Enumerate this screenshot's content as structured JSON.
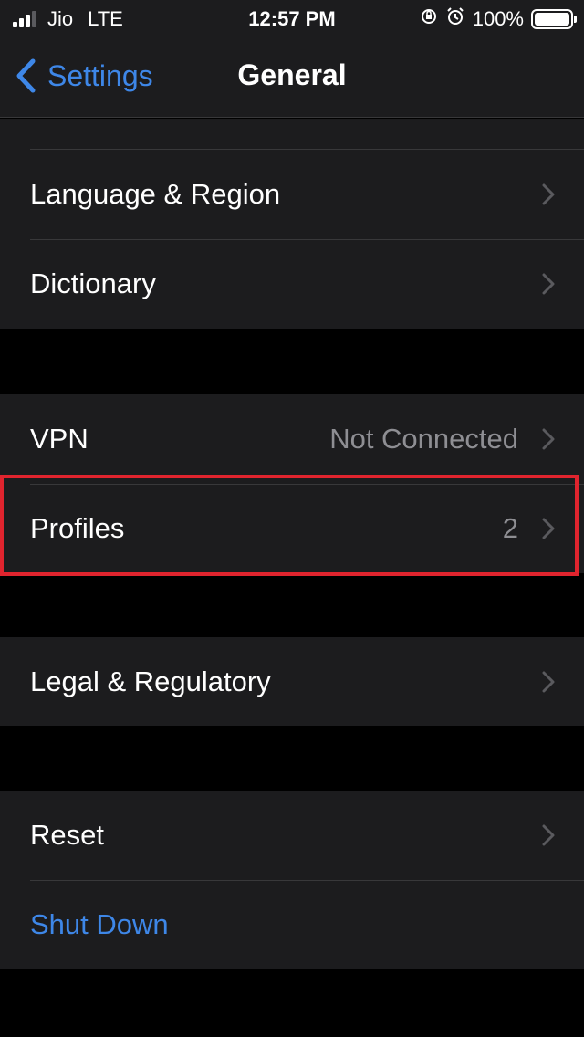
{
  "status_bar": {
    "carrier": "Jio",
    "network": "LTE",
    "time": "12:57 PM",
    "battery": "100%"
  },
  "nav": {
    "back_label": "Settings",
    "title": "General"
  },
  "groups": [
    {
      "rows": [
        {
          "label": "Language & Region",
          "value": ""
        },
        {
          "label": "Dictionary",
          "value": ""
        }
      ]
    },
    {
      "rows": [
        {
          "label": "VPN",
          "value": "Not Connected"
        },
        {
          "label": "Profiles",
          "value": "2"
        }
      ]
    },
    {
      "rows": [
        {
          "label": "Legal & Regulatory",
          "value": ""
        }
      ]
    },
    {
      "rows": [
        {
          "label": "Reset",
          "value": ""
        },
        {
          "label": "Shut Down",
          "value": ""
        }
      ]
    }
  ],
  "colors": {
    "accent": "#3e87e8",
    "background": "#000000",
    "cell": "#1c1c1e",
    "highlight": "#e0242e"
  }
}
